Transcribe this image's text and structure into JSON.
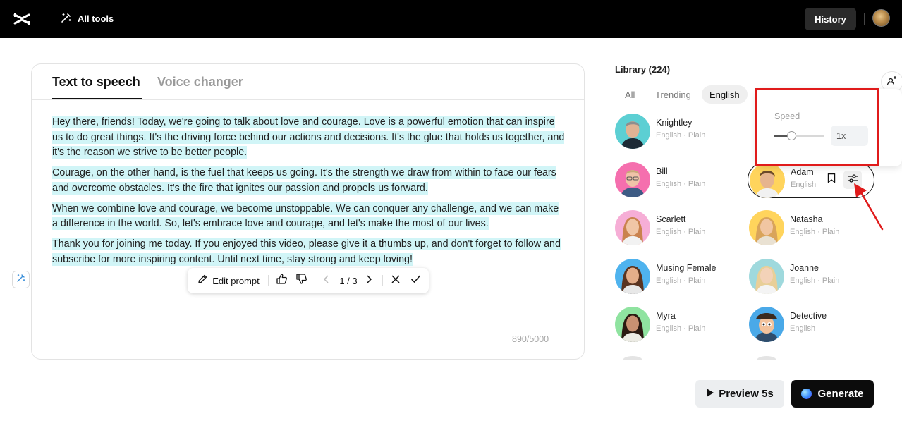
{
  "header": {
    "logo_icon": "capcut-logo-icon",
    "all_tools_label": "All tools",
    "history_label": "History"
  },
  "editor": {
    "tabs": [
      {
        "label": "Text to speech",
        "active": true
      },
      {
        "label": "Voice changer",
        "active": false
      }
    ],
    "paragraphs": [
      "Hey there, friends! Today, we're going to talk about love and courage. Love is a powerful emotion that can inspire us to do great things. It's the driving force behind our actions and decisions. It's the glue that holds us together, and it's the reason we strive to be better people.",
      "Courage, on the other hand, is the fuel that keeps us going. It's the strength we draw from within to face our fears and overcome obstacles. It's the fire that ignites our passion and propels us forward.",
      "When we combine love and courage, we become unstoppable. We can conquer any challenge, and we can make a difference in the world. So, let's embrace love and courage, and let's make the most of our lives.",
      "Thank you for joining me today. If you enjoyed this video, please give it a thumbs up, and don't forget to follow and subscribe for more inspiring content. Until next time, stay strong and keep loving!"
    ],
    "char_count": "890/5000",
    "highlight_color": "#d1f5f7"
  },
  "prompt_bar": {
    "edit_label": "Edit prompt",
    "page": "1 / 3"
  },
  "library": {
    "title": "Library (224)",
    "filters": [
      {
        "label": "All",
        "active": false
      },
      {
        "label": "Trending",
        "active": false
      },
      {
        "label": "English",
        "active": true
      }
    ],
    "voices": [
      {
        "name": "Knightley",
        "meta": "English · Plain"
      },
      {
        "name": "Bill",
        "meta": "English · Plain"
      },
      {
        "name": "Adam",
        "meta": "English · Plain",
        "selected": true
      },
      {
        "name": "Scarlett",
        "meta": "English · Plain"
      },
      {
        "name": "Natasha",
        "meta": "English · Plain"
      },
      {
        "name": "Musing Female",
        "meta": "English · Plain"
      },
      {
        "name": "Joanne",
        "meta": "English · Plain"
      },
      {
        "name": "Myra",
        "meta": "English · Plain"
      },
      {
        "name": "Detective",
        "meta": "English"
      }
    ]
  },
  "speed_popup": {
    "label": "Speed",
    "value": "1x",
    "slider_level": 0.35
  },
  "actions": {
    "preview_label": "Preview 5s",
    "generate_label": "Generate"
  },
  "colors": {
    "annotation_red": "#e01b1b",
    "topbar": "#000000"
  }
}
